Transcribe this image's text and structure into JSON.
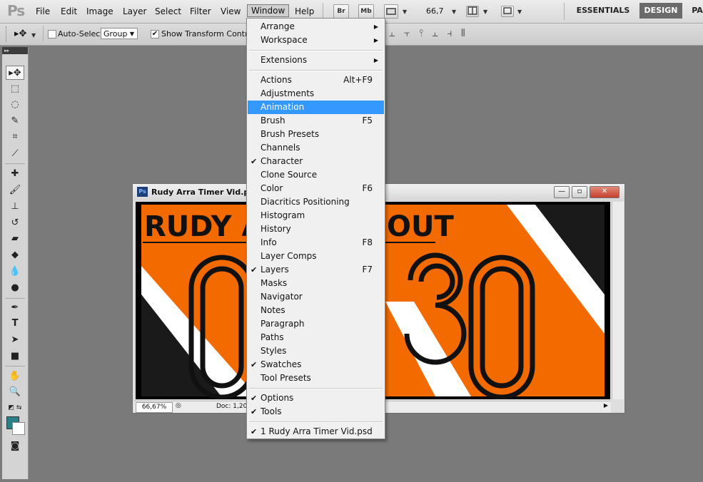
{
  "menubar": {
    "logo": "Ps",
    "menus": [
      "File",
      "Edit",
      "Image",
      "Layer",
      "Select",
      "Filter",
      "View",
      "Window",
      "Help"
    ],
    "bridge": "Br",
    "minibridge": "Mb",
    "zoom": "66,7",
    "workspaces": [
      "ESSENTIALS",
      "DESIGN",
      "PA"
    ]
  },
  "options": {
    "auto_select_label": "Auto-Select:",
    "auto_select_value": "Group",
    "transform_label": "Show Transform Controls"
  },
  "document": {
    "title": "Rudy Arra Timer Vid.psd @",
    "zoom": "66,67%",
    "doc_info": "Doc: 1,20",
    "canvas_text_top": "RUDY AR",
    "canvas_text_top_right": "OUT",
    "canvas_digits_left": "0",
    "canvas_digits_right": "30"
  },
  "window_menu": {
    "items": [
      {
        "label": "Arrange",
        "submenu": true
      },
      {
        "label": "Workspace",
        "submenu": true
      },
      {
        "sep": true
      },
      {
        "label": "Extensions",
        "submenu": true
      },
      {
        "sep": true
      },
      {
        "label": "Actions",
        "shortcut": "Alt+F9"
      },
      {
        "label": "Adjustments"
      },
      {
        "label": "Animation",
        "highlighted": true
      },
      {
        "label": "Brush",
        "shortcut": "F5"
      },
      {
        "label": "Brush Presets"
      },
      {
        "label": "Channels"
      },
      {
        "label": "Character",
        "checked": true
      },
      {
        "label": "Clone Source"
      },
      {
        "label": "Color",
        "shortcut": "F6"
      },
      {
        "label": "Diacritics Positioning"
      },
      {
        "label": "Histogram"
      },
      {
        "label": "History"
      },
      {
        "label": "Info",
        "shortcut": "F8"
      },
      {
        "label": "Layer Comps"
      },
      {
        "label": "Layers",
        "shortcut": "F7",
        "checked": true
      },
      {
        "label": "Masks"
      },
      {
        "label": "Navigator"
      },
      {
        "label": "Notes"
      },
      {
        "label": "Paragraph"
      },
      {
        "label": "Paths"
      },
      {
        "label": "Styles"
      },
      {
        "label": "Swatches",
        "checked": true
      },
      {
        "label": "Tool Presets"
      },
      {
        "sep": true
      },
      {
        "label": "Options",
        "checked": true
      },
      {
        "label": "Tools",
        "checked": true
      },
      {
        "sep": true
      },
      {
        "label": "1 Rudy Arra Timer Vid.psd",
        "checked": true
      }
    ]
  },
  "colors": {
    "foreground": "#2a7f88",
    "background": "#ffffff",
    "highlight": "#3399ff",
    "canvas_orange": "#f26a00"
  },
  "icons": {
    "check": "✔",
    "submenu_arrow": "▶"
  }
}
